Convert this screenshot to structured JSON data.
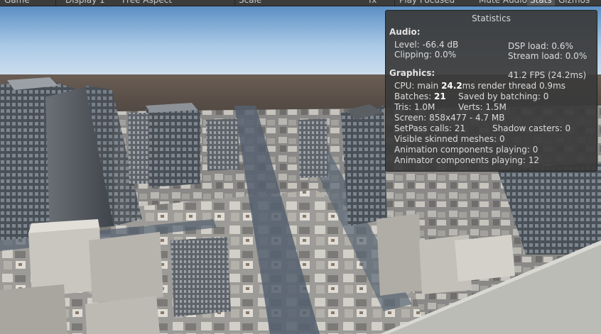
{
  "toolbar": {
    "tab_label": "Game",
    "display": "Display 1",
    "aspect": "Free Aspect",
    "scale_label": "Scale",
    "fx": "fx",
    "play_mode": "Play Focused",
    "mute_audio": "Mute Audio",
    "stats_toggle": "Stats",
    "gizmos": "Gizmos"
  },
  "stats": {
    "title": "Statistics",
    "audio": {
      "heading": "Audio:",
      "level": "Level: -66.4 dB",
      "clipping": "Clipping: 0.0%",
      "dsp_load": "DSP load: 0.6%",
      "stream_load": "Stream load: 0.0%"
    },
    "graphics": {
      "heading": "Graphics:",
      "fps": "41.2 FPS (24.2ms)",
      "cpu_prefix": "CPU: main ",
      "cpu_main": "24.2",
      "cpu_suffix": "ms  render thread 0.9ms",
      "batches_prefix": "Batches: ",
      "batches": "21",
      "saved_by_batching": "Saved by batching: 0",
      "tris": "Tris: 1.0M",
      "verts": "Verts: 1.5M",
      "screen": "Screen: 858x477 - 4.7 MB",
      "setpass": "SetPass calls: 21",
      "shadow_casters": "Shadow casters: 0",
      "skinned_meshes": "Visible skinned meshes: 0",
      "animation_components": "Animation components playing: 0",
      "animator_components": "Animator components playing: 12"
    }
  },
  "colors": {
    "panel_bg": "#3a3a3a",
    "toolbar_bg": "#3c3c3c",
    "text": "#dcdcdc"
  }
}
